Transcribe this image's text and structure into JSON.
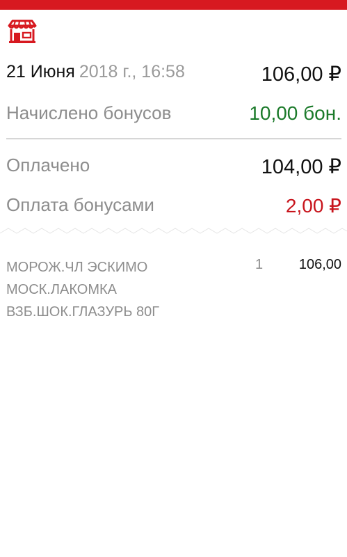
{
  "header": {
    "store_icon": "store-icon",
    "accent_color": "#d71920"
  },
  "receipt": {
    "date_day": "21 Июня",
    "date_rest": "2018 г., 16:58",
    "total": "106,00 ₽",
    "accrued_label": "Начислено бонусов",
    "accrued_value": "10,00 бон.",
    "paid_label": "Оплачено",
    "paid_value": "104,00 ₽",
    "paid_bonus_label": "Оплата бонусами",
    "paid_bonus_value": "2,00 ₽"
  },
  "items": [
    {
      "name": "МОРОЖ.ЧЛ ЭСКИМО МОСК.ЛАКОМКА ВЗБ.ШОК.ГЛАЗУРЬ 80Г",
      "qty": "1",
      "price": "106,00"
    }
  ],
  "colors": {
    "green": "#1b7a2a",
    "red": "#c8141c",
    "grey_text": "#8d8d8d"
  }
}
